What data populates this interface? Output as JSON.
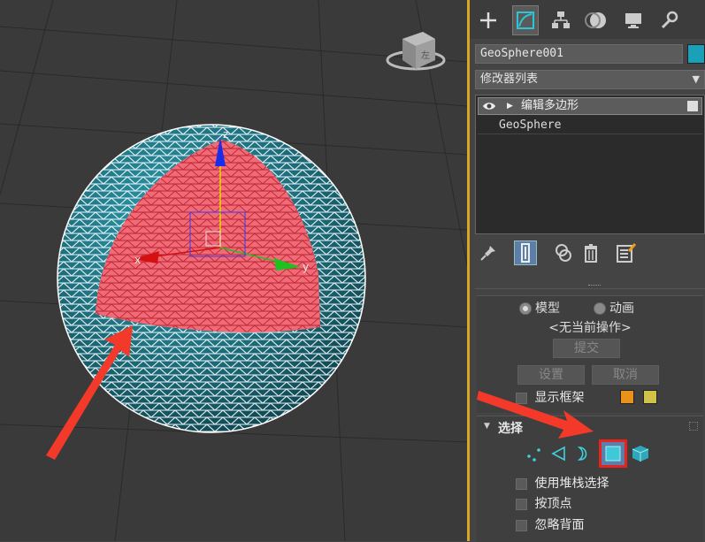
{
  "viewport": {
    "gizmo_axes": {
      "z": "z",
      "x": "x",
      "y": "y"
    },
    "viewcube_label": "左"
  },
  "panel": {
    "tabs": [
      {
        "icon": "plus-icon",
        "label": "+"
      },
      {
        "icon": "modify-icon"
      },
      {
        "icon": "hierarchy-icon"
      },
      {
        "icon": "motion-icon"
      },
      {
        "icon": "display-icon"
      },
      {
        "icon": "utilities-icon"
      }
    ],
    "object_name": "GeoSphere001",
    "object_color": "#1aa0b8",
    "modifier_list_label": "修改器列表",
    "stack": {
      "item1": "编辑多边形",
      "item2": "GeoSphere"
    },
    "edit_section": {
      "mode_model": "模型",
      "mode_anim": "动画",
      "current_op": "<无当前操作>",
      "commit": "提交",
      "settings": "设置",
      "cancel": "取消",
      "show_cage": "显示框架",
      "cage_colors": [
        "#e8921b",
        "#cfc34a"
      ]
    },
    "selection_section": {
      "title": "选择",
      "use_stack_selection": "使用堆栈选择",
      "by_vertex": "按顶点",
      "ignore_backfacing": "忽略背面"
    }
  }
}
